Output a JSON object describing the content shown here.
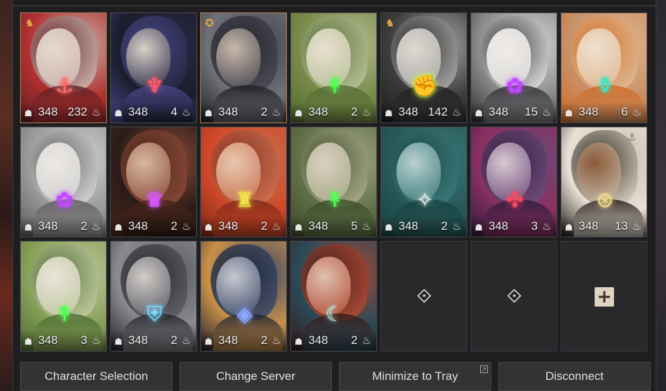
{
  "characters": [
    {
      "ilvl": "348",
      "rest": "232",
      "selected": true,
      "badge": "party",
      "emblem": "⚓",
      "emblem_color": "#ff6a6a",
      "palette": [
        "#c7b4ad",
        "#5a1e22",
        "#e8d8d0",
        "#b23030"
      ]
    },
    {
      "ilvl": "348",
      "rest": "4",
      "selected": false,
      "badge": "",
      "emblem": "♆",
      "emblem_color": "#ff5a6a",
      "palette": [
        "#2a2a48",
        "#4a4a90",
        "#d8d0c8",
        "#1c1c2c"
      ]
    },
    {
      "ilvl": "348",
      "rest": "2",
      "selected": true,
      "badge": "gold",
      "emblem": "",
      "emblem_color": "#ffffff",
      "palette": [
        "#454550",
        "#1c1c22",
        "#c8b8a8",
        "#707078"
      ]
    },
    {
      "ilvl": "348",
      "rest": "2",
      "selected": false,
      "badge": "",
      "emblem": "↟",
      "emblem_color": "#52ff52",
      "palette": [
        "#b8c098",
        "#506a30",
        "#e8e0d0",
        "#788a48"
      ]
    },
    {
      "ilvl": "348",
      "rest": "142",
      "selected": false,
      "badge": "party",
      "emblem": "✊",
      "emblem_color": "#c8ff3a",
      "palette": [
        "#a8a8a8",
        "#1c1c1c",
        "#e0d8d0",
        "#3c3c3c"
      ]
    },
    {
      "ilvl": "348",
      "rest": "15",
      "selected": false,
      "badge": "",
      "emblem": "✿",
      "emblem_color": "#c248ff",
      "palette": [
        "#d8d8d8",
        "#2a2a2e",
        "#f0ece8",
        "#8a8a8a"
      ]
    },
    {
      "ilvl": "348",
      "rest": "6",
      "selected": false,
      "badge": "",
      "emblem": "⚱",
      "emblem_color": "#38e8c8",
      "palette": [
        "#e0b890",
        "#d06820",
        "#f0e0d0",
        "#c89068"
      ]
    },
    {
      "ilvl": "348",
      "rest": "2",
      "selected": false,
      "badge": "",
      "emblem": "✿",
      "emblem_color": "#c248ff",
      "palette": [
        "#d0d0d0",
        "#5a5a5a",
        "#ece8e4",
        "#9a9a9a"
      ]
    },
    {
      "ilvl": "348",
      "rest": "2",
      "selected": false,
      "badge": "",
      "emblem": "♛",
      "emblem_color": "#d858ff",
      "palette": [
        "#8a4a38",
        "#4a2418",
        "#d8b8a0",
        "#2a1c18"
      ]
    },
    {
      "ilvl": "348",
      "rest": "2",
      "selected": false,
      "badge": "",
      "emblem": "♜",
      "emblem_color": "#f0e048",
      "palette": [
        "#c87050",
        "#7a2818",
        "#e8c8b0",
        "#d04828"
      ]
    },
    {
      "ilvl": "348",
      "rest": "5",
      "selected": false,
      "badge": "",
      "emblem": "↟",
      "emblem_color": "#52ff52",
      "palette": [
        "#a8a888",
        "#3a4a28",
        "#d8d0c0",
        "#607048"
      ]
    },
    {
      "ilvl": "348",
      "rest": "2",
      "selected": false,
      "badge": "",
      "emblem": "✧",
      "emblem_color": "#e8f0f0",
      "palette": [
        "#3a7878",
        "#184040",
        "#b8d0d0",
        "#285858"
      ]
    },
    {
      "ilvl": "348",
      "rest": "3",
      "selected": false,
      "badge": "",
      "emblem": "✣",
      "emblem_color": "#ff4860",
      "palette": [
        "#6a4a78",
        "#2a1a3a",
        "#d8c8d0",
        "#8a3060"
      ]
    },
    {
      "ilvl": "348",
      "rest": "13",
      "selected": false,
      "badge": "anchor",
      "emblem": "⊛",
      "emblem_color": "#f0d890",
      "palette": [
        "#c8c0b0",
        "#1a1410",
        "#8a5a38",
        "#e8e0d4"
      ]
    },
    {
      "ilvl": "348",
      "rest": "3",
      "selected": false,
      "badge": "",
      "emblem": "↟",
      "emblem_color": "#52ff52",
      "palette": [
        "#c0c8a0",
        "#486a30",
        "#e8e4d8",
        "#88a058"
      ]
    },
    {
      "ilvl": "348",
      "rest": "2",
      "selected": false,
      "badge": "",
      "emblem": "⛨",
      "emblem_color": "#78d8ff",
      "palette": [
        "#585860",
        "#1e1e24",
        "#d0ccc8",
        "#8a8a90"
      ]
    },
    {
      "ilvl": "348",
      "rest": "2",
      "selected": false,
      "badge": "",
      "emblem": "◈",
      "emblem_color": "#8aa8ff",
      "palette": [
        "#384868",
        "#1a1e2c",
        "#c8c8d0",
        "#c89048"
      ]
    },
    {
      "ilvl": "348",
      "rest": "2",
      "selected": false,
      "badge": "",
      "emblem": "☾",
      "emblem_color": "#a8f0e8",
      "palette": [
        "#b04830",
        "#3a1a18",
        "#e0c0b0",
        "#2a4a58"
      ]
    }
  ],
  "empty_slots": [
    {
      "kind": "unlocked",
      "icon": "diamond-arrow-icon"
    },
    {
      "kind": "unlocked",
      "icon": "diamond-arrow-icon"
    },
    {
      "kind": "add",
      "icon": "plus-icon"
    }
  ],
  "buttons": {
    "character_selection": "Character Selection",
    "change_server": "Change Server",
    "minimize_to_tray": "Minimize to Tray",
    "disconnect": "Disconnect"
  },
  "colors": {
    "selected_border": "#b08858",
    "panel_bg": "#1e1e21",
    "button_bg": "#333336"
  }
}
